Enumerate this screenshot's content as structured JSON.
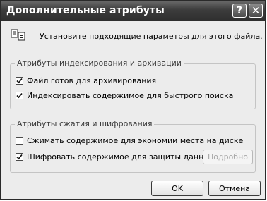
{
  "window": {
    "title": "Дополнительные атрибуты",
    "help_glyph": "?",
    "close_glyph": "✕"
  },
  "description": "Установите подходящие параметры для этого файла.",
  "group_index": {
    "label": "Атрибуты индексирования и архивации",
    "items": [
      {
        "label": "Файл готов для архивирования",
        "checked": true
      },
      {
        "label": "Индексировать содержимое для быстрого поиска",
        "checked": true
      }
    ]
  },
  "group_compress": {
    "label": "Атрибуты сжатия и шифрования",
    "items": [
      {
        "label": "Сжимать содержимое для экономии места на диске",
        "checked": false
      },
      {
        "label": "Шифровать содержимое для защиты данных",
        "checked": true
      }
    ],
    "details_button": "Подробно"
  },
  "buttons": {
    "ok": "OK",
    "cancel": "Отмена"
  },
  "icons": {
    "help": "help-icon",
    "close": "close-icon",
    "file_attributes": "file-attributes-icon",
    "checkmark": "checkmark-icon"
  }
}
